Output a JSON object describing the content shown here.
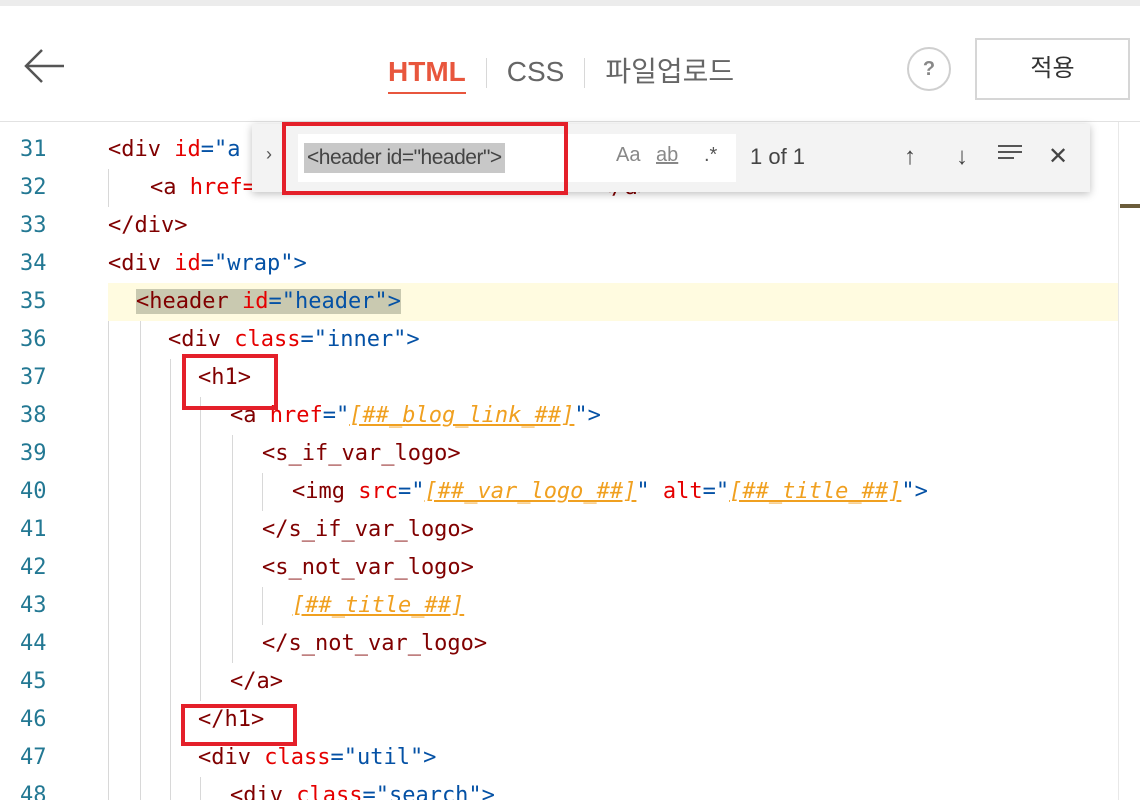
{
  "header": {
    "tabs": [
      {
        "label": "HTML",
        "active": true
      },
      {
        "label": "CSS",
        "active": false
      },
      {
        "label": "파일업로드",
        "active": false
      }
    ],
    "help_label": "?",
    "apply_label": "적용"
  },
  "find": {
    "query": "<header id=\"header\">",
    "match_case": "Aa",
    "whole_word": "ab",
    "regex": ".*",
    "count": "1 of 1"
  },
  "editor": {
    "line_numbers": [
      "31",
      "32",
      "33",
      "34",
      "35",
      "36",
      "37",
      "38",
      "39",
      "40",
      "41",
      "42",
      "43",
      "44",
      "45",
      "46",
      "47",
      "48"
    ],
    "highlighted_line": "35",
    "lines": {
      "l31": [
        "<div",
        "id",
        "=\"",
        "a"
      ],
      "l32": [
        "<a",
        "href=",
        "",
        "",
        "</a>"
      ],
      "l33": [
        "</div>"
      ],
      "l34": [
        "<div",
        "id",
        "=\"wrap\">"
      ],
      "l35": [
        "<header",
        "id",
        "=\"header\">"
      ],
      "l36": [
        "<div",
        "class",
        "=\"inner\">"
      ],
      "l37": [
        "<h1>"
      ],
      "l38": [
        "<a",
        "href",
        "=\"",
        "[##_blog_link_##]",
        "\">"
      ],
      "l39": [
        "<s_if_var_logo>"
      ],
      "l40": [
        "<img",
        "src",
        "=\"",
        "[##_var_logo_##]",
        "\"",
        "alt",
        "=\"",
        "[##_title_##]",
        "\">"
      ],
      "l41": [
        "</s_if_var_logo>"
      ],
      "l42": [
        "<s_not_var_logo>"
      ],
      "l43": [
        "[##_title_##]"
      ],
      "l44": [
        "</s_not_var_logo>"
      ],
      "l45": [
        "</a>"
      ],
      "l46": [
        "</h1>"
      ],
      "l47": [
        "<div",
        "class",
        "=\"util\">"
      ],
      "l48": [
        "<div",
        "class",
        "=\"search\">"
      ]
    }
  },
  "colors": {
    "accent": "#e8563d",
    "annotation_red": "#e4202a",
    "line_number": "#237893",
    "tag": "#800000",
    "attribute": "#e50000",
    "value": "#0451a5",
    "template_var": "#f0a020"
  }
}
